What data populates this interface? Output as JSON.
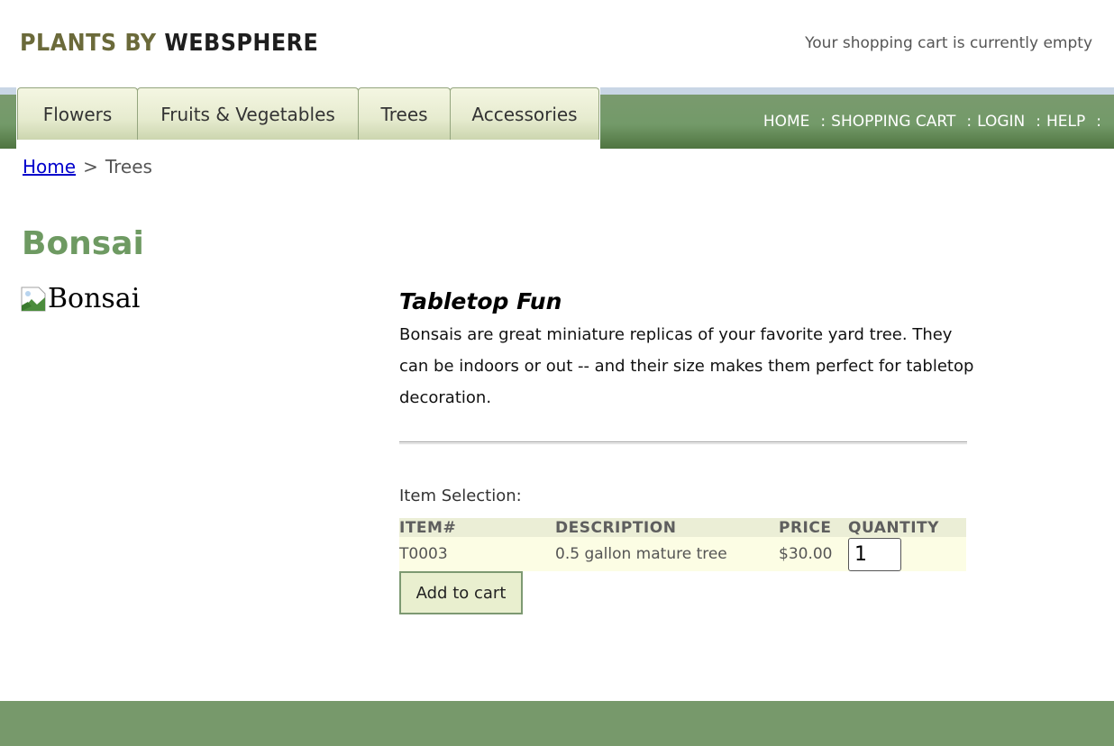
{
  "header": {
    "logo_part1": "PLANTS BY ",
    "logo_part2": "WEBSPHERE",
    "cart_status": "Your shopping cart is currently empty"
  },
  "nav": {
    "tabs": [
      {
        "label": "Flowers"
      },
      {
        "label": "Fruits & Vegetables"
      },
      {
        "label": "Trees"
      },
      {
        "label": "Accessories"
      }
    ],
    "links": [
      {
        "label": "HOME"
      },
      {
        "label": "SHOPPING CART"
      },
      {
        "label": "LOGIN"
      },
      {
        "label": "HELP"
      }
    ],
    "separator": ":"
  },
  "breadcrumb": {
    "home": "Home",
    "sep": ">",
    "current": "Trees"
  },
  "product": {
    "title": "Bonsai",
    "image_alt": "Bonsai",
    "subtitle": "Tabletop Fun",
    "description": "Bonsais are great miniature replicas of your favorite yard tree. They can be indoors or out -- and their size makes them perfect for tabletop decoration."
  },
  "selection": {
    "label": "Item Selection:",
    "columns": [
      "ITEM#",
      "DESCRIPTION",
      "PRICE",
      "QUANTITY"
    ],
    "rows": [
      {
        "item": "T0003",
        "description": "0.5 gallon mature tree",
        "price": "$30.00",
        "quantity": "1"
      }
    ],
    "add_button": "Add to cart"
  },
  "colors": {
    "brand_green": "#6e9a62",
    "nav_green": "#739a69",
    "tab_bg": "#e6ebcf",
    "footer": "#77996b",
    "link_blue": "#0000cc"
  },
  "icons": {
    "broken_image": "broken-image-icon"
  }
}
